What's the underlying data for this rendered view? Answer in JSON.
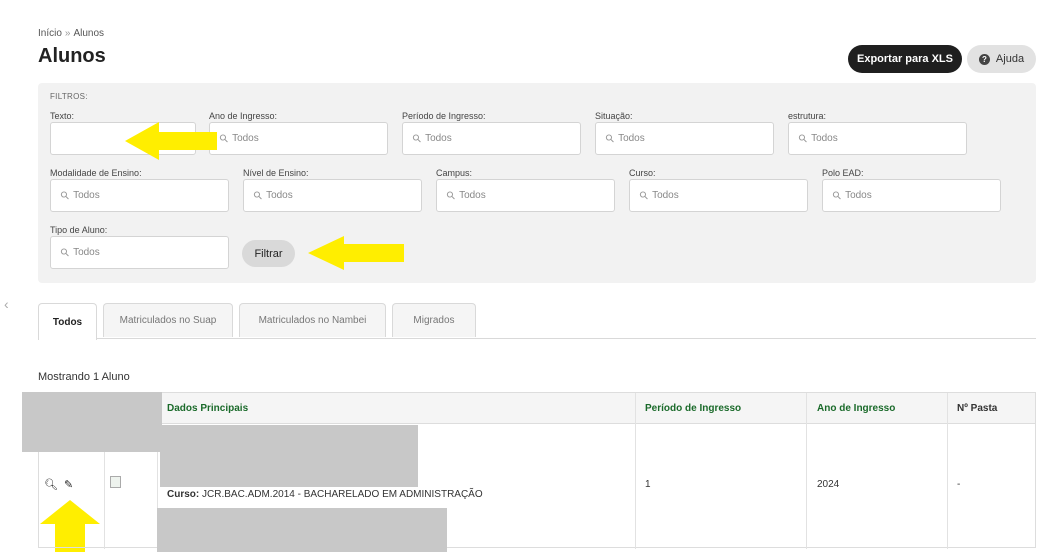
{
  "breadcrumb": {
    "home": "Início",
    "separator": "»",
    "current": "Alunos"
  },
  "page": {
    "title": "Alunos"
  },
  "actions": {
    "export_label": "Exportar para XLS",
    "help_label": "Ajuda",
    "help_icon": "question-circle-icon"
  },
  "filters": {
    "title": "FILTROS:",
    "fields": {
      "texto": {
        "label": "Texto:",
        "placeholder": ""
      },
      "ano_ingresso": {
        "label": "Ano de Ingresso:",
        "placeholder": "Todos"
      },
      "periodo_ingresso": {
        "label": "Período de Ingresso:",
        "placeholder": "Todos"
      },
      "situacao": {
        "label": "Situação:",
        "placeholder": "Todos"
      },
      "estrutura": {
        "label": "estrutura:",
        "placeholder": "Todos"
      },
      "modalidade": {
        "label": "Modalidade de Ensino:",
        "placeholder": "Todos"
      },
      "nivel": {
        "label": "Nível de Ensino:",
        "placeholder": "Todos"
      },
      "campus": {
        "label": "Campus:",
        "placeholder": "Todos"
      },
      "curso": {
        "label": "Curso:",
        "placeholder": "Todos"
      },
      "polo": {
        "label": "Polo EAD:",
        "placeholder": "Todos"
      },
      "tipo_aluno": {
        "label": "Tipo de Aluno:",
        "placeholder": "Todos"
      }
    },
    "submit_label": "Filtrar"
  },
  "tabs": [
    {
      "label": "Todos",
      "active": true
    },
    {
      "label": "Matriculados no Suap",
      "active": false
    },
    {
      "label": "Matriculados no Nambei",
      "active": false
    },
    {
      "label": "Migrados",
      "active": false
    }
  ],
  "results": {
    "showing_text": "Mostrando 1 Aluno"
  },
  "table": {
    "headers": {
      "dados": "Dados Principais",
      "periodo": "Período de Ingresso",
      "ano": "Ano de Ingresso",
      "pasta": "Nº Pasta"
    },
    "rows": [
      {
        "curso_label": "Curso:",
        "curso_value": "JCR.BAC.ADM.2014 - BACHARELADO EM ADMINISTRAÇÃO",
        "periodo": "1",
        "ano": "2024",
        "pasta": "-"
      }
    ]
  },
  "colors": {
    "accent_header": "#1a6a2a",
    "arrow": "#ffee00",
    "dark_button": "#1f1f1f"
  }
}
